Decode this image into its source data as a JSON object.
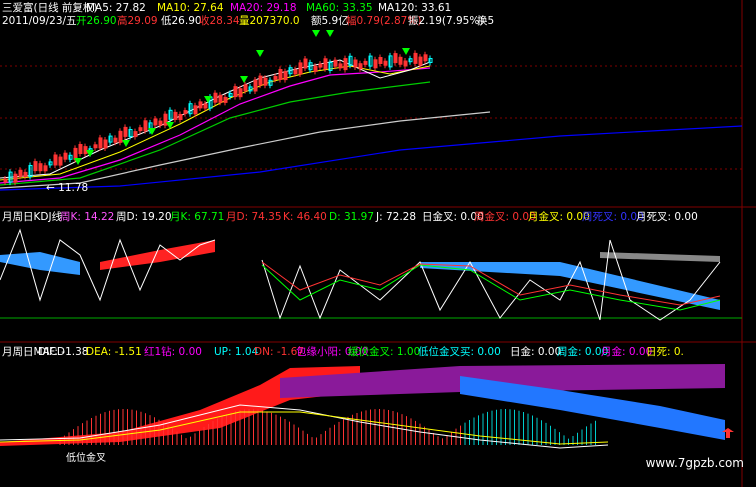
{
  "header": {
    "stock": "三爱富(日线 前复权)",
    "ma5": "MA5: 27.82",
    "ma10": "MA10: 27.64",
    "ma20": "MA20: 29.18",
    "ma60": "MA60: 33.35",
    "ma120": "MA120: 33.61",
    "date": "2011/09/23/五",
    "open": "开26.90",
    "high": "高29.09",
    "low": "低26.90",
    "close": "收28.34",
    "volume": "量207370.0",
    "amount": "额5.9亿",
    "change": "幅0.79(2.87%)",
    "amplitude": "振2.19(7.95%)",
    "turnover": "换5"
  },
  "price_panel": {
    "low_marker": "11.78"
  },
  "kdj_panel": {
    "title": "月周日KDJ线",
    "labels": [
      {
        "text": "周K: 14.22",
        "color": "#ff55ff"
      },
      {
        "text": "周D: 19.20",
        "color": "#ffffff"
      },
      {
        "text": "月K: 67.71",
        "color": "#00ff00"
      },
      {
        "text": "月D: 74.35",
        "color": "#ff3333"
      },
      {
        "text": "K: 46.40",
        "color": "#ff3333"
      },
      {
        "text": "D: 31.97",
        "color": "#00ff00"
      },
      {
        "text": "J: 72.28",
        "color": "#ffffff"
      },
      {
        "text": "日金叉: 0.00",
        "color": "#ffffff"
      },
      {
        "text": "周金叉: 0.00",
        "color": "#ff3333"
      },
      {
        "text": "月金叉: 0.00",
        "color": "#ffff00"
      },
      {
        "text": "周死叉: 0.00",
        "color": "#3333ff"
      },
      {
        "text": "月死叉: 0.00",
        "color": "#ffffff"
      }
    ]
  },
  "macd_panel": {
    "title": "月周日MACD",
    "annotation": "低位金叉",
    "labels": [
      {
        "text": "DIF: -1.38",
        "color": "#ffffff"
      },
      {
        "text": "DEA: -1.51",
        "color": "#ffff00"
      },
      {
        "text": "红1钻: 0.00",
        "color": "#ff00ff"
      },
      {
        "text": "UP: 1.04",
        "color": "#00ffff"
      },
      {
        "text": "DN: -1.67",
        "color": "#ff3333"
      },
      {
        "text": "包缘小阳: 0.00",
        "color": "#ff00ff"
      },
      {
        "text": "缓伏金叉: 1.00",
        "color": "#00ff00"
      },
      {
        "text": "低位金叉买: 0.00",
        "color": "#00ffff"
      },
      {
        "text": "日金: 0.00",
        "color": "#ffffff"
      },
      {
        "text": "周金: 0.00",
        "color": "#00ffff"
      },
      {
        "text": "月金: 0.00",
        "color": "#ff00ff"
      },
      {
        "text": "日死: 0.",
        "color": "#ffff00"
      }
    ]
  },
  "watermark": "www.7gpzb.com",
  "colors": {
    "background": "#000000",
    "grid": "#800000",
    "ma5": "#ffffff",
    "ma10": "#ffff00",
    "ma20": "#ff00ff",
    "ma60": "#00cc00",
    "ma120": "#ffffff",
    "ma250": "#0000ff",
    "up_candle": "#ff3333",
    "down_candle": "#00ffff"
  },
  "chart_data": {
    "type": "line",
    "title": "三爱富(日线 前复权)",
    "series": [
      {
        "name": "MA5",
        "last": 27.82
      },
      {
        "name": "MA10",
        "last": 27.64
      },
      {
        "name": "MA20",
        "last": 29.18
      },
      {
        "name": "MA60",
        "last": 33.35
      },
      {
        "name": "MA120",
        "last": 33.61
      }
    ],
    "ohlc_latest": {
      "open": 26.9,
      "high": 29.09,
      "low": 26.9,
      "close": 28.34,
      "volume": 207370.0
    },
    "kdj": {
      "K": 46.4,
      "D": 31.97,
      "J": 72.28,
      "week_K": 14.22,
      "week_D": 19.2,
      "month_K": 67.71,
      "month_D": 74.35
    },
    "macd": {
      "DIF": -1.38,
      "DEA": -1.51,
      "UP": 1.04,
      "DN": -1.67
    }
  }
}
